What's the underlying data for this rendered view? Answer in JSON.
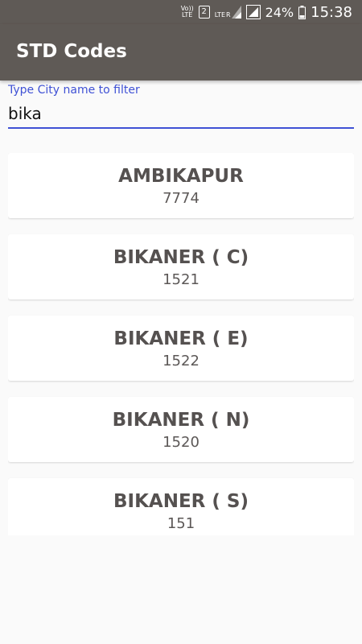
{
  "status_bar": {
    "volte_top": "Vo))",
    "volte_bottom": "LTE",
    "sim": "2",
    "lte": "LTE",
    "roaming": "R",
    "battery": "24%",
    "time": "15:38",
    "icons": [
      "volte-icon",
      "sim-2-icon",
      "lte-signal-icon",
      "signal-icon",
      "battery-icon"
    ]
  },
  "app_bar": {
    "title": "STD Codes"
  },
  "filter": {
    "label": "Type City name to filter",
    "value": "bika"
  },
  "results": [
    {
      "city": "AMBIKAPUR",
      "code": "7774"
    },
    {
      "city": "BIKANER ( C)",
      "code": "1521"
    },
    {
      "city": "BIKANER ( E)",
      "code": "1522"
    },
    {
      "city": "BIKANER ( N)",
      "code": "1520"
    },
    {
      "city": "BIKANER ( S)",
      "code": "151"
    }
  ],
  "colors": {
    "app_bar": "#5f5a56",
    "accent": "#3f51d5",
    "background": "#fafafa",
    "card": "#ffffff",
    "text": "#555150"
  }
}
